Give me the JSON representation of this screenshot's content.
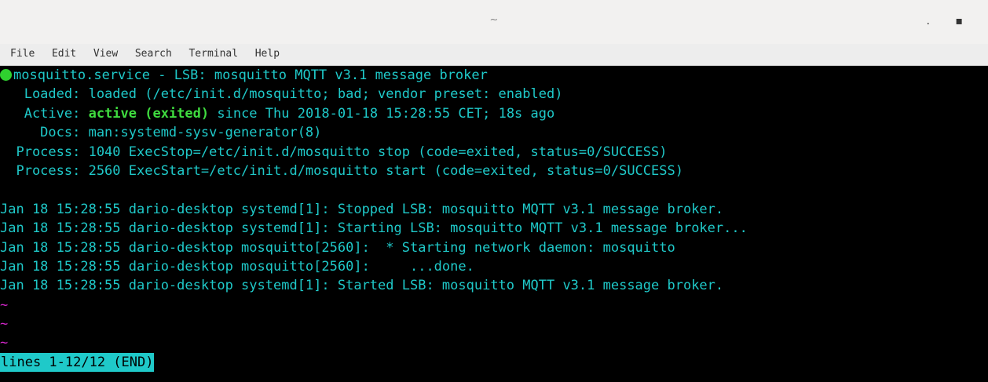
{
  "window": {
    "title": "~",
    "min_glyph": ".",
    "max_glyph": "▪"
  },
  "menu": [
    "File",
    "Edit",
    "View",
    "Search",
    "Terminal",
    "Help"
  ],
  "service": {
    "header": "mosquitto.service - LSB: mosquitto MQTT v3.1 message broker",
    "loaded": "   Loaded: loaded (/etc/init.d/mosquitto; bad; vendor preset: enabled)",
    "active_prefix": "   Active: ",
    "active_state": "active (exited)",
    "active_suffix": " since Thu 2018-01-18 15:28:55 CET; 18s ago",
    "docs": "     Docs: man:systemd-sysv-generator(8)",
    "process1": "  Process: 1040 ExecStop=/etc/init.d/mosquitto stop (code=exited, status=0/SUCCESS)",
    "process2": "  Process: 2560 ExecStart=/etc/init.d/mosquitto start (code=exited, status=0/SUCCESS)"
  },
  "log": [
    "Jan 18 15:28:55 dario-desktop systemd[1]: Stopped LSB: mosquitto MQTT v3.1 message broker.",
    "Jan 18 15:28:55 dario-desktop systemd[1]: Starting LSB: mosquitto MQTT v3.1 message broker...",
    "Jan 18 15:28:55 dario-desktop mosquitto[2560]:  * Starting network daemon: mosquitto",
    "Jan 18 15:28:55 dario-desktop mosquitto[2560]:     ...done.",
    "Jan 18 15:28:55 dario-desktop systemd[1]: Started LSB: mosquitto MQTT v3.1 message broker."
  ],
  "tilde": "~",
  "pager_status": "lines 1-12/12 (END)",
  "colors": {
    "text": "#1fc9c9",
    "active": "#3fdc3f",
    "tilde": "#d026c7",
    "background": "#000000"
  }
}
